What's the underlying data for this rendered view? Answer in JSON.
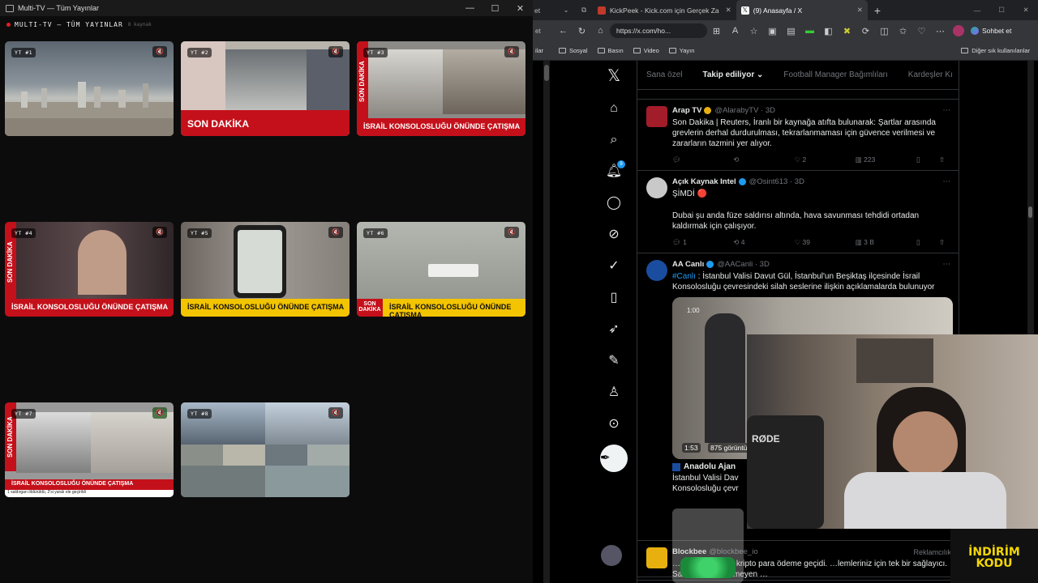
{
  "multitv": {
    "window_title": "Multi-TV — Tüm Yayınlar",
    "header_title": "MULTI-TV — TÜM YAYINLAR",
    "header_count": "8 kaynak",
    "tiles": [
      {
        "label": "YT #1",
        "lower": ""
      },
      {
        "label": "YT #2",
        "lower": "SON DAKİKA"
      },
      {
        "label": "YT #3",
        "lower": "İSRAİL KONSOLOSLUĞU ÖNÜNDE ÇATIŞMA"
      },
      {
        "label": "YT #4",
        "lower": "İSRAİL KONSOLOSLUĞU ÖNÜNDE ÇATIŞMA"
      },
      {
        "label": "YT #5",
        "lower": "İSRAİL KONSOLOSLUĞU ÖNÜNDE ÇATIŞMA"
      },
      {
        "label": "YT #6",
        "lower": "İSRAİL KONSOLOSLUĞU ÖNÜNDE ÇATIŞMA"
      },
      {
        "label": "YT #7",
        "lower": "İSRAİL KONSOLOSLUĞU ÖNÜNDE ÇATIŞMA"
      },
      {
        "label": "YT #8",
        "lower": ""
      }
    ],
    "tile7_ticker": "1 saldırgan öldürüldü, 2'si yaralı ele geçirildi",
    "side_text": "SON DAKİKA",
    "mute_icon": "🔇"
  },
  "browser": {
    "tabs": [
      {
        "title": "KickPeek - Kick.com için Gerçek Za",
        "active": false,
        "color": "#c0392b"
      },
      {
        "title": "(9) Anasayfa / X",
        "active": true,
        "color": "#000000"
      }
    ],
    "partial_tab": "et",
    "url": "https://x.com/ho...",
    "profile_label": "Sohbet et",
    "bookmarks": [
      "Sosyal",
      "Basın",
      "Video",
      "Yayın"
    ],
    "bookmarks_left": "ilar",
    "other_bookmarks": "Diğer sık kullanılanlar"
  },
  "x": {
    "feed_tabs": [
      "Sana özel",
      "Takip ediliyor",
      "Football Manager Bağımlıları",
      "Kardeşler Kı"
    ],
    "notif_badge": "9",
    "tweets": [
      {
        "name": "Arap TV",
        "handle": "@AlarabyTV",
        "time": "3D",
        "body": "Son Dakika | Reuters, İranlı bir kaynağa atıfta bulunarak: Şartlar arasında grevlerin derhal durdurulması, tekrarlanmaması için güvence verilmesi ve zararların tazmini yer alıyor.",
        "reply": "",
        "retweet": "",
        "like": "2",
        "views": "223"
      },
      {
        "name": "Açık Kaynak Intel",
        "handle": "@Osint613",
        "time": "3D",
        "body_line1": "ŞİMDİ 🔴",
        "body": "Dubai şu anda füze saldırısı altında, hava savunması tehdidi ortadan kaldırmak için çalışıyor.",
        "reply": "1",
        "retweet": "4",
        "like": "39",
        "views": "3 B"
      },
      {
        "name": "AA Canlı",
        "handle": "@AACanli",
        "time": "3D",
        "tag": "#Canlı",
        "body": " : İstanbul Valisi Davut Gül, İstanbul'un Beşiktaş ilçesinde İsrail Konsolosluğu çevresindeki silah seslerine ilişkin açıklamalarda bulunuyor",
        "media_time": "1:53",
        "media_views": "875 görüntü",
        "media_start": "1:00",
        "quote_name": "Anadolu Ajan",
        "quote_body": "İstanbul Valisi Dav Konsolosluğu çevr"
      }
    ],
    "ad": {
      "name": "Blockbee",
      "handle": "@blockbee_io",
      "ad_label": "Reklamcılık",
      "body": "…n için kapsamlı kripto para ödeme geçidi. …lemleriniz için tek bir sağlayıcı. Saklama gerektirmeyen …"
    }
  },
  "overlay": {
    "mic_brand": "RØDE",
    "promo": "İNDİRİM KODU"
  }
}
